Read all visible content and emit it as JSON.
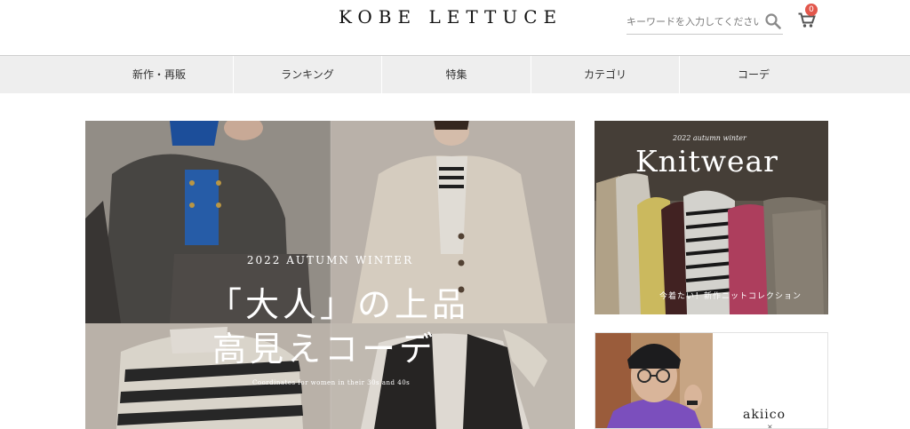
{
  "header": {
    "logo": "KOBE LETTUCE",
    "search_placeholder": "キーワードを入力してください",
    "cart_count": "0"
  },
  "nav": {
    "items": [
      {
        "label": "新作・再販"
      },
      {
        "label": "ランキング"
      },
      {
        "label": "特集"
      },
      {
        "label": "カテゴリ"
      },
      {
        "label": "コーデ"
      }
    ]
  },
  "hero": {
    "season": "2022 AUTUMN WINTER",
    "headline_1": "「大人」の上品",
    "headline_2": "高見えコーデ",
    "caption": "Coordinates for women in their 30s and 40s"
  },
  "knit_banner": {
    "season": "2022 autumn winter",
    "title": "Knitwear",
    "caption": "今着たい！新作ニットコレクション"
  },
  "akiico_banner": {
    "brand": "akiico",
    "mark": "×"
  },
  "colors": {
    "nav_background": "#eeeeee",
    "cart_badge": "#e2574c",
    "text": "#333333"
  }
}
